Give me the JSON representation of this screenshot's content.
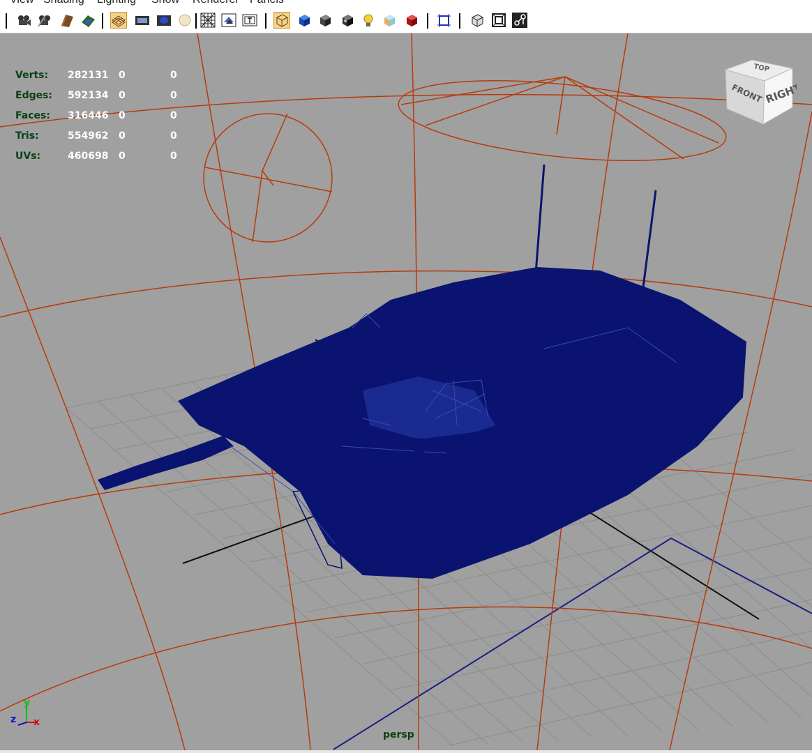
{
  "menubar": {
    "items": [
      "View",
      "Shading",
      "Lighting",
      "Show",
      "Renderer",
      "Panels"
    ]
  },
  "toolbar": {
    "icons": [
      "select-camera-icon",
      "camera-attributes-icon",
      "bookmarks-icon",
      "image-plane-icon",
      "grid-icon",
      "film-gate-icon",
      "resolution-gate-icon",
      "gate-mask-icon",
      "field-chart-icon",
      "safe-action-icon",
      "safe-title-icon",
      "wireframe-icon",
      "smooth-shade-icon",
      "wireframe-on-shaded-icon",
      "xray-icon",
      "use-default-light-icon",
      "textured-icon",
      "shadows-icon",
      "isolate-select-icon",
      "high-quality-icon",
      "xray-joints-icon",
      "xray-active-icon"
    ]
  },
  "hud": {
    "rows": [
      {
        "label": "Verts:",
        "total": "282131",
        "selected": "0",
        "components": "0"
      },
      {
        "label": "Edges:",
        "total": "592134",
        "selected": "0",
        "components": "0"
      },
      {
        "label": "Faces:",
        "total": "316446",
        "selected": "0",
        "components": "0"
      },
      {
        "label": "Tris:",
        "total": "554962",
        "selected": "0",
        "components": "0"
      },
      {
        "label": "UVs:",
        "total": "460698",
        "selected": "0",
        "components": "0"
      }
    ]
  },
  "viewcube": {
    "top": "TOP",
    "front": "FRONT",
    "right": "RIGHT"
  },
  "axes": {
    "y": "y",
    "z": "z",
    "x": "x",
    "x_color": "#d01010",
    "y_color": "#10c010",
    "z_color": "#1010d0"
  },
  "camera": {
    "name": "persp"
  },
  "colors": {
    "viewport_bg": "#a0a0a0",
    "camera_lines": "#b83a0c",
    "wireframe": "#0a1470",
    "grid": "#8c8c8c",
    "hud_label": "#0b3f14",
    "hud_value": "#ffffff"
  }
}
